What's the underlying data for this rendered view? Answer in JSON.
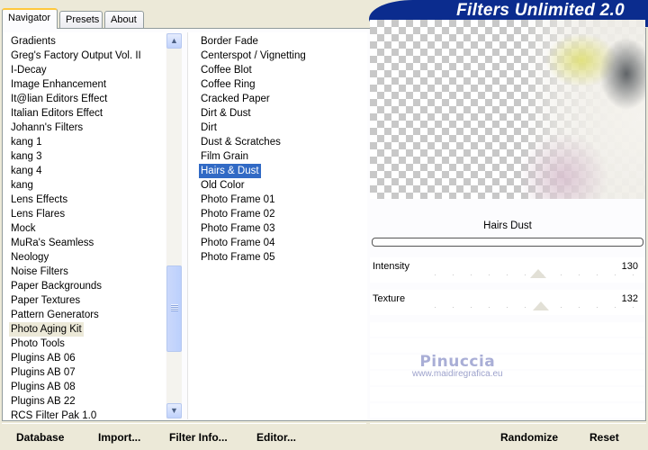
{
  "tabs": [
    "Navigator",
    "Presets",
    "About"
  ],
  "title": "Filters Unlimited 2.0",
  "categories": [
    "Gradients",
    "Greg's Factory Output Vol. II",
    "I-Decay",
    "Image Enhancement",
    "It@lian Editors Effect",
    "Italian Editors Effect",
    "Johann's Filters",
    "kang 1",
    "kang 3",
    "kang 4",
    "kang",
    "Lens Effects",
    "Lens Flares",
    "Mock",
    "MuRa's Seamless",
    "Neology",
    "Noise Filters",
    "Paper Backgrounds",
    "Paper Textures",
    "Pattern Generators",
    "Photo Aging Kit",
    "Photo Tools",
    "Plugins AB 06",
    "Plugins AB 07",
    "Plugins AB 08",
    "Plugins AB 22",
    "RCS Filter Pak 1.0"
  ],
  "selected_category_index": 20,
  "filters": [
    "Border Fade",
    "Centerspot / Vignetting",
    "Coffee Blot",
    "Coffee Ring",
    "Cracked Paper",
    "Dirt & Dust",
    "Dirt",
    "Dust & Scratches",
    "Film Grain",
    "Hairs & Dust",
    "Old Color",
    "Photo Frame 01",
    "Photo Frame 02",
    "Photo Frame 03",
    "Photo Frame 04",
    "Photo Frame 05"
  ],
  "selected_filter_index": 9,
  "current_filter_name": "Hairs  Dust",
  "sliders": [
    {
      "label": "Intensity",
      "value": "130",
      "fraction": 0.51
    },
    {
      "label": "Texture",
      "value": "132",
      "fraction": 0.52
    }
  ],
  "watermark": {
    "name": "Pinuccia",
    "site": "www.maidiregrafica.eu"
  },
  "buttons": {
    "database": "Database",
    "import": "Import...",
    "filter_info": "Filter Info...",
    "editor": "Editor...",
    "randomize": "Randomize",
    "reset": "Reset"
  },
  "scroll_icons": {
    "up": "chevron-up-icon",
    "down": "chevron-down-icon"
  },
  "colors": {
    "selection": "#316ac5",
    "banner": "#0b2c8e"
  }
}
